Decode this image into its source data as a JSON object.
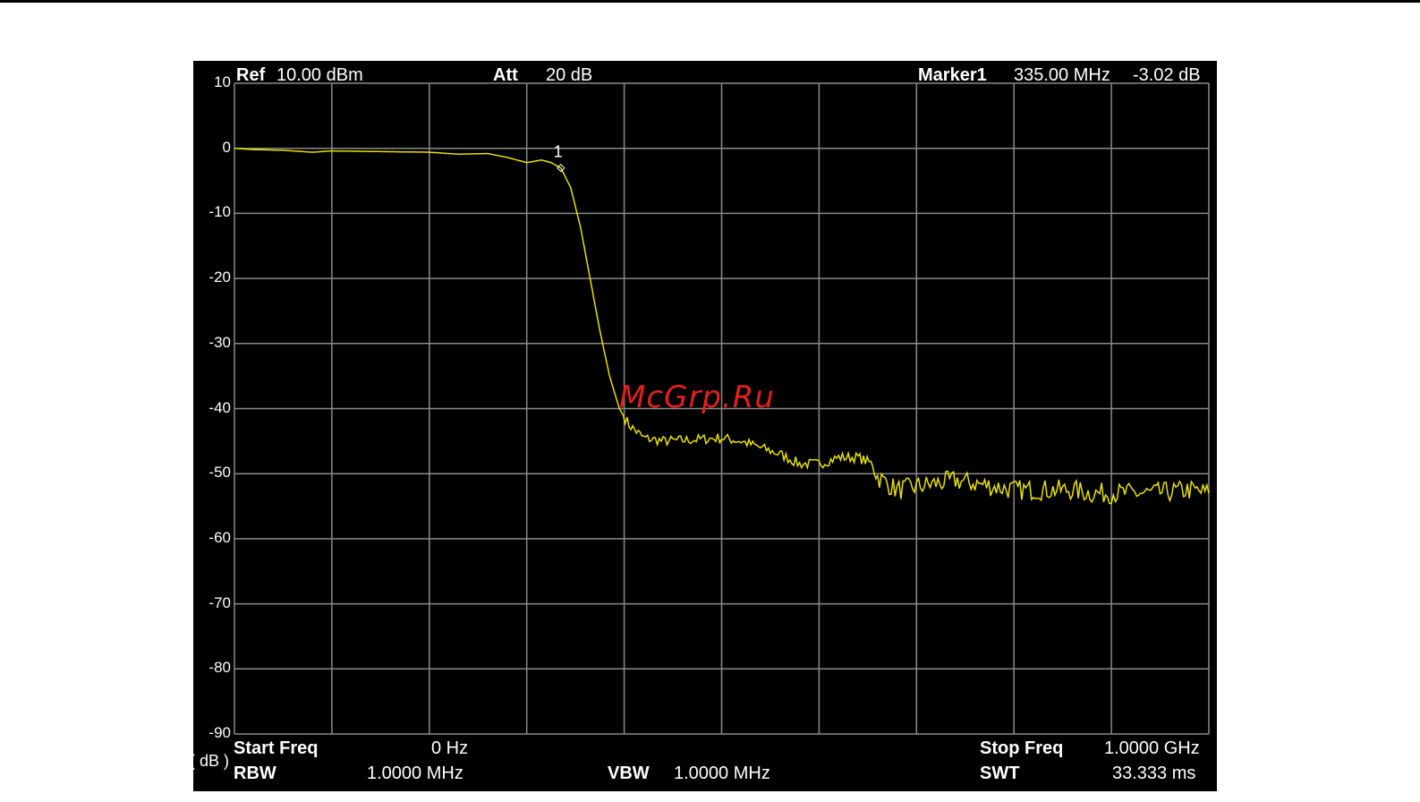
{
  "header": {
    "ref_label": "Ref",
    "ref_value": "10.00 dBm",
    "att_label": "Att",
    "att_value": "20 dB",
    "marker_label": "Marker1",
    "marker_freq": "335.00 MHz",
    "marker_level": "-3.02 dB"
  },
  "footer": {
    "unit_label": "( dB )",
    "start_label": "Start Freq",
    "start_value": "0 Hz",
    "stop_label": "Stop Freq",
    "stop_value": "1.0000 GHz",
    "rbw_label": "RBW",
    "rbw_value": "1.0000 MHz",
    "vbw_label": "VBW",
    "vbw_value": "1.0000 MHz",
    "swt_label": "SWT",
    "swt_value": "33.333 ms"
  },
  "watermark": "McGrp.Ru",
  "colors": {
    "screen_bg": "#000000",
    "grid": "#8a8a8a",
    "trace": "#e8e000",
    "text": "#ffffff",
    "watermark": "#e02020"
  },
  "chart_data": {
    "type": "line",
    "xlim": [
      0,
      1000
    ],
    "ylim": [
      -90,
      10
    ],
    "yticks": [
      "10",
      "0",
      "-10",
      "-20",
      "-30",
      "-40",
      "-50",
      "-60",
      "-70",
      "-80",
      "-90"
    ],
    "grid": true,
    "marker": {
      "label": "1",
      "x": 335,
      "y": -3.02
    },
    "series": [
      {
        "points": [
          [
            0,
            0
          ],
          [
            20,
            -0.2
          ],
          [
            50,
            -0.3
          ],
          [
            80,
            -0.6
          ],
          [
            100,
            -0.4
          ],
          [
            150,
            -0.5
          ],
          [
            200,
            -0.6
          ],
          [
            230,
            -0.9
          ],
          [
            260,
            -0.8
          ],
          [
            280,
            -1.4
          ],
          [
            300,
            -2.2
          ],
          [
            315,
            -1.8
          ],
          [
            325,
            -2.2
          ],
          [
            335,
            -3.02
          ],
          [
            345,
            -6
          ],
          [
            355,
            -12
          ],
          [
            365,
            -20
          ],
          [
            375,
            -28
          ],
          [
            385,
            -35
          ],
          [
            395,
            -40
          ],
          [
            405,
            -42.5
          ],
          [
            420,
            -44.5
          ],
          [
            440,
            -45
          ],
          [
            470,
            -44.8
          ],
          [
            500,
            -44.5
          ],
          [
            520,
            -45
          ],
          [
            540,
            -46
          ],
          [
            560,
            -47
          ],
          [
            580,
            -48.5
          ],
          [
            600,
            -48.5
          ],
          [
            620,
            -47.5
          ],
          [
            640,
            -47.5
          ],
          [
            655,
            -48.5
          ],
          [
            660,
            -50.5
          ],
          [
            680,
            -52.5
          ],
          [
            700,
            -52
          ],
          [
            720,
            -51.5
          ],
          [
            740,
            -51
          ],
          [
            760,
            -51.5
          ],
          [
            780,
            -52
          ],
          [
            800,
            -52.5
          ],
          [
            820,
            -52.5
          ],
          [
            840,
            -52.5
          ],
          [
            860,
            -52.5
          ],
          [
            880,
            -53
          ],
          [
            900,
            -53
          ],
          [
            920,
            -53
          ],
          [
            940,
            -53
          ],
          [
            960,
            -52.8
          ],
          [
            980,
            -52.5
          ],
          [
            1000,
            -53
          ]
        ]
      }
    ]
  }
}
